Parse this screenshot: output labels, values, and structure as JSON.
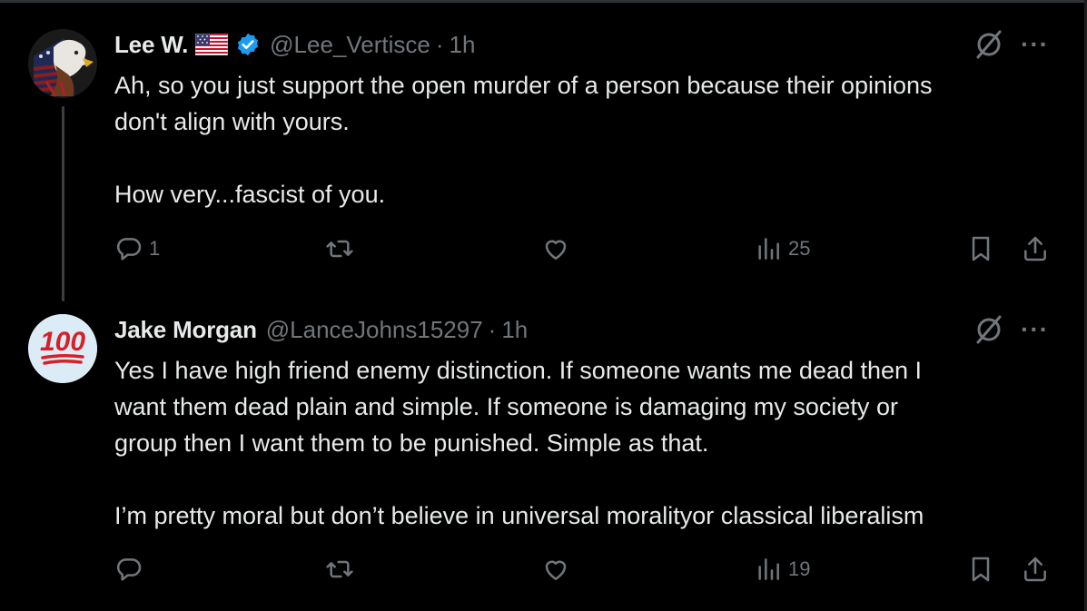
{
  "tweets": [
    {
      "name": "Lee W.",
      "handle": "@Lee_Vertisce",
      "separator": "·",
      "time": "1h",
      "text": "Ah, so you just support the open murder of a person because their opinions\ndon't align with yours.\n\nHow very...fascist of you.",
      "replies": "1",
      "reposts": "",
      "likes": "",
      "views": "25",
      "avatar_icon": "eagle-flag-avatar",
      "has_flag_emoji": true,
      "verified": true
    },
    {
      "name": "Jake Morgan",
      "handle": "@LanceJohns15297",
      "separator": "·",
      "time": "1h",
      "text": "Yes I have high friend enemy distinction. If someone wants me dead then I\nwant them dead plain and simple. If someone is damaging my society or\ngroup then I want them to be punished. Simple as that.\n\nI’m pretty moral but don’t believe in universal moralityor classical liberalism",
      "replies": "",
      "reposts": "",
      "likes": "",
      "views": "19",
      "avatar_icon": "hundred-points-emoji-avatar",
      "avatar_emoji": "💯",
      "has_flag_emoji": false,
      "verified": false
    }
  ],
  "colors": {
    "background": "#000000",
    "text": "#e7e9ea",
    "muted": "#71767b",
    "verified": "#1d9bf0",
    "thread_line": "#3a3f44"
  },
  "more_label": "···"
}
